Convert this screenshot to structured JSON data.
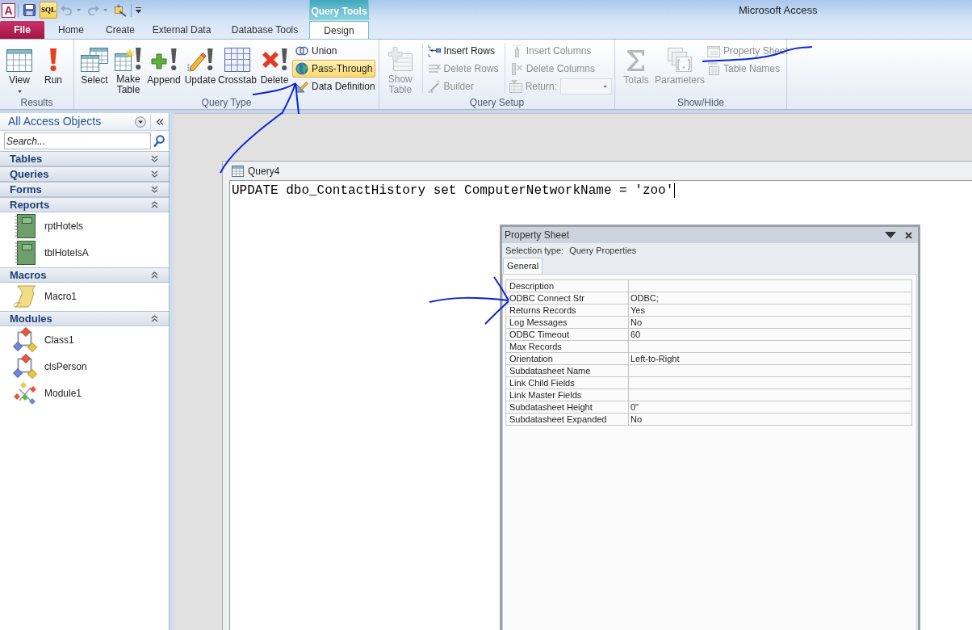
{
  "window": {
    "title": "Microsoft Access",
    "app_logo": "A"
  },
  "quick_access_toolbar": {
    "sql_view": {
      "label": "SQL",
      "selected": true
    },
    "undo": {
      "disabled": true
    },
    "redo": {
      "disabled": true
    }
  },
  "contextual_tab_group": {
    "label": "Query Tools"
  },
  "tabs": [
    {
      "label": "File",
      "kind": "backstage",
      "selected": false
    },
    {
      "label": "Home",
      "kind": "tab",
      "selected": false
    },
    {
      "label": "Create",
      "kind": "tab",
      "selected": false
    },
    {
      "label": "External Data",
      "kind": "tab",
      "selected": false
    },
    {
      "label": "Database Tools",
      "kind": "tab",
      "selected": false
    },
    {
      "label": "Design",
      "kind": "contextual",
      "selected": true
    }
  ],
  "ribbon": {
    "groups": [
      {
        "label": "Results",
        "controls": [
          {
            "kind": "large",
            "label": "View",
            "dropdown": true,
            "disabled": false
          },
          {
            "kind": "large",
            "label": "Run",
            "disabled": false
          }
        ]
      },
      {
        "label": "Query Type",
        "controls": [
          {
            "kind": "large",
            "label": "Select",
            "selected": false,
            "disabled": false
          },
          {
            "kind": "large",
            "label": "Make Table",
            "selected": false,
            "disabled": false
          },
          {
            "kind": "large",
            "label": "Append",
            "selected": false,
            "disabled": false
          },
          {
            "kind": "large",
            "label": "Update",
            "selected": false,
            "disabled": false
          },
          {
            "kind": "large",
            "label": "Crosstab",
            "selected": false,
            "disabled": false
          },
          {
            "kind": "large",
            "label": "Delete",
            "selected": false,
            "disabled": false
          },
          {
            "kind": "small",
            "label": "Union",
            "selected": false,
            "disabled": false
          },
          {
            "kind": "small",
            "label": "Pass-Through",
            "selected": true,
            "disabled": false
          },
          {
            "kind": "small",
            "label": "Data Definition",
            "selected": false,
            "disabled": false
          }
        ]
      },
      {
        "label": "Query Setup",
        "controls": [
          {
            "kind": "large",
            "label": "Show Table",
            "disabled": true
          },
          {
            "kind": "small",
            "label": "Insert Rows",
            "disabled": false
          },
          {
            "kind": "small",
            "label": "Delete Rows",
            "disabled": true
          },
          {
            "kind": "small",
            "label": "Builder",
            "disabled": true
          },
          {
            "kind": "small",
            "label": "Insert Columns",
            "disabled": true
          },
          {
            "kind": "small",
            "label": "Delete Columns",
            "disabled": true
          },
          {
            "kind": "combo",
            "label": "Return:",
            "disabled": true
          }
        ]
      },
      {
        "label": "Show/Hide",
        "controls": [
          {
            "kind": "large",
            "label": "Totals",
            "disabled": true
          },
          {
            "kind": "large",
            "label": "Parameters",
            "disabled": true
          },
          {
            "kind": "small",
            "label": "Property Sheet",
            "disabled": true
          },
          {
            "kind": "small",
            "label": "Table Names",
            "disabled": true
          }
        ]
      }
    ]
  },
  "navigation_pane": {
    "title": "All Access Objects",
    "search": {
      "placeholder": "Search..."
    },
    "groups": [
      {
        "label": "Tables",
        "expanded": false
      },
      {
        "label": "Queries",
        "expanded": false
      },
      {
        "label": "Forms",
        "expanded": false
      },
      {
        "label": "Reports",
        "expanded": true,
        "items": [
          {
            "label": "rptHotels",
            "kind": "report"
          },
          {
            "label": "tblHotelsA",
            "kind": "report"
          }
        ]
      },
      {
        "label": "Macros",
        "expanded": true,
        "items": [
          {
            "label": "Macro1",
            "kind": "macro"
          }
        ]
      },
      {
        "label": "Modules",
        "expanded": true,
        "items": [
          {
            "label": "Class1",
            "kind": "class"
          },
          {
            "label": "clsPerson",
            "kind": "class"
          },
          {
            "label": "Module1",
            "kind": "module"
          }
        ]
      }
    ]
  },
  "query_window": {
    "title": "Query4",
    "sql": "UPDATE dbo_ContactHistory set ComputerNetworkName = 'zoo'"
  },
  "property_sheet": {
    "title": "Property Sheet",
    "selection_type": {
      "label": "Selection type:",
      "value": "Query Properties"
    },
    "tabs": [
      {
        "label": "General",
        "selected": true
      }
    ],
    "properties": [
      {
        "name": "Description"
      },
      {
        "name": "ODBC Connect Str",
        "value": "ODBC;"
      },
      {
        "name": "Returns Records",
        "value": "Yes"
      },
      {
        "name": "Log Messages",
        "value": "No"
      },
      {
        "name": "ODBC Timeout",
        "value": "60"
      },
      {
        "name": "Max Records"
      },
      {
        "name": "Orientation",
        "value": "Left-to-Right"
      },
      {
        "name": "Subdatasheet Name"
      },
      {
        "name": "Link Child Fields"
      },
      {
        "name": "Link Master Fields"
      },
      {
        "name": "Subdatasheet Height",
        "value": "0\""
      },
      {
        "name": "Subdatasheet Expanded",
        "value": "No"
      }
    ]
  }
}
